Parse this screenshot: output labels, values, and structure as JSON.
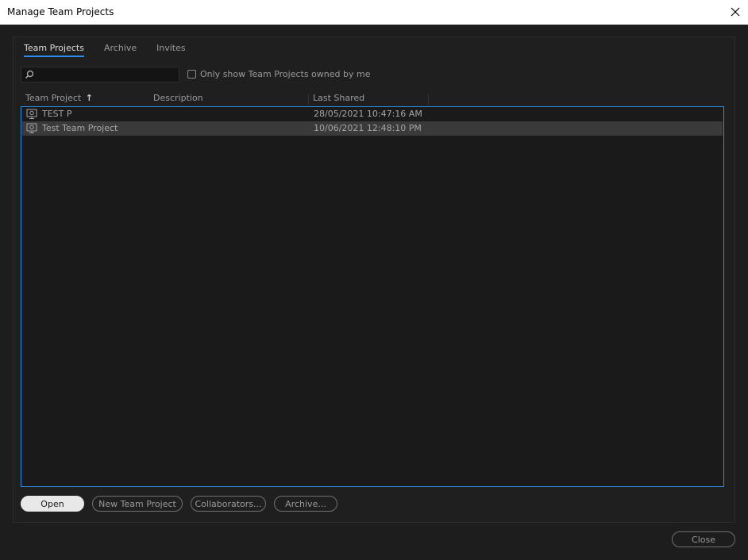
{
  "window": {
    "title": "Manage Team Projects"
  },
  "tabs": [
    {
      "label": "Team Projects",
      "active": true
    },
    {
      "label": "Archive",
      "active": false
    },
    {
      "label": "Invites",
      "active": false
    }
  ],
  "search": {
    "value": "",
    "placeholder": ""
  },
  "filter": {
    "owned_label": "Only show Team Projects owned by me",
    "checked": false
  },
  "table": {
    "columns": {
      "name": "Team Project",
      "description": "Description",
      "last_shared": "Last Shared"
    },
    "sort_indicator": "↑",
    "rows": [
      {
        "name": "TEST P",
        "description": "",
        "last_shared": "28/05/2021 10:47:16 AM",
        "selected": false
      },
      {
        "name": "Test Team Project",
        "description": "",
        "last_shared": "10/06/2021 12:48:10 PM",
        "selected": true
      }
    ]
  },
  "buttons": {
    "open": "Open",
    "new_team_project": "New Team Project",
    "collaborators": "Collaborators...",
    "archive": "Archive...",
    "close": "Close"
  },
  "icons": {
    "close": "close-icon",
    "search": "search-icon",
    "project": "team-project-icon",
    "sort": "sort-ascending-icon"
  },
  "colors": {
    "accent": "#2d8ceb",
    "background": "#1d1d1d",
    "selected_row": "#3a3a3a"
  }
}
